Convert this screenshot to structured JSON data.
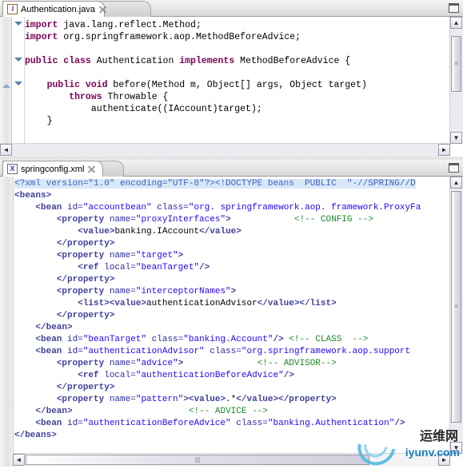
{
  "window": {
    "maximize_label": "Maximize"
  },
  "java_editor": {
    "tab": {
      "title": "Authentication.java",
      "icon": "java-file-icon",
      "icon_glyph": "J",
      "close_icon": "close-icon"
    },
    "lines": [
      [
        {
          "t": "import",
          "c": "kw"
        },
        {
          "t": " java.lang.reflect.Method;",
          "c": "plain"
        }
      ],
      [
        {
          "t": "import",
          "c": "kw"
        },
        {
          "t": " org.springframework.aop.MethodBeforeAdvice;",
          "c": "plain"
        }
      ],
      [],
      [
        {
          "t": "public class",
          "c": "kw"
        },
        {
          "t": " Authentication ",
          "c": "plain"
        },
        {
          "t": "implements",
          "c": "kw"
        },
        {
          "t": " MethodBeforeAdvice {",
          "c": "plain"
        }
      ],
      [],
      [
        {
          "t": "    ",
          "c": "plain"
        },
        {
          "t": "public void",
          "c": "kw"
        },
        {
          "t": " before(Method m, Object[] args, Object target)",
          "c": "plain"
        }
      ],
      [
        {
          "t": "        ",
          "c": "plain"
        },
        {
          "t": "throws",
          "c": "kw"
        },
        {
          "t": " Throwable {",
          "c": "plain"
        }
      ],
      [
        {
          "t": "            authenticate((IAccount)target);",
          "c": "plain"
        }
      ],
      [
        {
          "t": "    }",
          "c": "plain"
        }
      ]
    ],
    "fold_markers": [
      "collapse-fold-line-1",
      "collapse-fold-line-4",
      "collapse-fold-line-6"
    ],
    "scroll": {
      "vertical_up": "▲",
      "vertical_down": "▼",
      "horizontal_left": "◄",
      "horizontal_right": "►"
    }
  },
  "xml_editor": {
    "tab": {
      "title": "springconfig.xml",
      "icon": "xml-file-icon",
      "icon_glyph": "X",
      "close_icon": "close-icon"
    },
    "lines": [
      [
        {
          "t": "<?xml version=\"1.0\" encoding=\"UTF-8\"?><!DOCTYPE beans  PUBLIC  \"-//SPRING//D",
          "c": "xdecl hl"
        }
      ],
      [
        {
          "t": "<beans>",
          "c": "xtag"
        }
      ],
      [
        {
          "t": "    ",
          "c": "xtext"
        },
        {
          "t": "<bean ",
          "c": "xtag"
        },
        {
          "t": "id=",
          "c": "xattr"
        },
        {
          "t": "\"accountbean\"",
          "c": "xval"
        },
        {
          "t": " class=",
          "c": "xattr"
        },
        {
          "t": "\"org. springframework.aop. framework.ProxyFa",
          "c": "xval"
        }
      ],
      [
        {
          "t": "        ",
          "c": "xtext"
        },
        {
          "t": "<property ",
          "c": "xtag"
        },
        {
          "t": "name=",
          "c": "xattr"
        },
        {
          "t": "\"proxyInterfaces\"",
          "c": "xval"
        },
        {
          "t": ">",
          "c": "xtag"
        },
        {
          "t": "            ",
          "c": "xtext"
        },
        {
          "t": "<!-- CONFIG -->",
          "c": "xcom"
        }
      ],
      [
        {
          "t": "            ",
          "c": "xtext"
        },
        {
          "t": "<value>",
          "c": "xtag"
        },
        {
          "t": "banking.IAccount",
          "c": "xtext"
        },
        {
          "t": "</value>",
          "c": "xtag"
        }
      ],
      [
        {
          "t": "        ",
          "c": "xtext"
        },
        {
          "t": "</property>",
          "c": "xtag"
        }
      ],
      [
        {
          "t": "        ",
          "c": "xtext"
        },
        {
          "t": "<property ",
          "c": "xtag"
        },
        {
          "t": "name=",
          "c": "xattr"
        },
        {
          "t": "\"target\"",
          "c": "xval"
        },
        {
          "t": ">",
          "c": "xtag"
        }
      ],
      [
        {
          "t": "            ",
          "c": "xtext"
        },
        {
          "t": "<ref ",
          "c": "xtag"
        },
        {
          "t": "local=",
          "c": "xattr"
        },
        {
          "t": "\"beanTarget\"",
          "c": "xval"
        },
        {
          "t": "/>",
          "c": "xtag"
        }
      ],
      [
        {
          "t": "        ",
          "c": "xtext"
        },
        {
          "t": "</property>",
          "c": "xtag"
        }
      ],
      [
        {
          "t": "        ",
          "c": "xtext"
        },
        {
          "t": "<property ",
          "c": "xtag"
        },
        {
          "t": "name=",
          "c": "xattr"
        },
        {
          "t": "\"interceptorNames\"",
          "c": "xval"
        },
        {
          "t": ">",
          "c": "xtag"
        }
      ],
      [
        {
          "t": "            ",
          "c": "xtext"
        },
        {
          "t": "<list><value>",
          "c": "xtag"
        },
        {
          "t": "authenticationAdvisor",
          "c": "xtext"
        },
        {
          "t": "</value></list>",
          "c": "xtag"
        }
      ],
      [
        {
          "t": "        ",
          "c": "xtext"
        },
        {
          "t": "</property>",
          "c": "xtag"
        }
      ],
      [
        {
          "t": "    ",
          "c": "xtext"
        },
        {
          "t": "</bean>",
          "c": "xtag"
        }
      ],
      [
        {
          "t": "    ",
          "c": "xtext"
        },
        {
          "t": "<bean ",
          "c": "xtag"
        },
        {
          "t": "id=",
          "c": "xattr"
        },
        {
          "t": "\"beanTarget\"",
          "c": "xval"
        },
        {
          "t": " class=",
          "c": "xattr"
        },
        {
          "t": "\"banking.Account\"",
          "c": "xval"
        },
        {
          "t": "/>",
          "c": "xtag"
        },
        {
          "t": " ",
          "c": "xtext"
        },
        {
          "t": "<!-- CLASS  -->",
          "c": "xcom"
        }
      ],
      [
        {
          "t": "    ",
          "c": "xtext"
        },
        {
          "t": "<bean ",
          "c": "xtag"
        },
        {
          "t": "id=",
          "c": "xattr"
        },
        {
          "t": "\"authenticationAdvisor\"",
          "c": "xval"
        },
        {
          "t": " class=",
          "c": "xattr"
        },
        {
          "t": "\"org.springframework.aop.support",
          "c": "xval"
        }
      ],
      [
        {
          "t": "        ",
          "c": "xtext"
        },
        {
          "t": "<property ",
          "c": "xtag"
        },
        {
          "t": "name=",
          "c": "xattr"
        },
        {
          "t": "\"advice\"",
          "c": "xval"
        },
        {
          "t": ">",
          "c": "xtag"
        },
        {
          "t": "              ",
          "c": "xtext"
        },
        {
          "t": "<!-- ADVISOR-->",
          "c": "xcom"
        }
      ],
      [
        {
          "t": "            ",
          "c": "xtext"
        },
        {
          "t": "<ref ",
          "c": "xtag"
        },
        {
          "t": "local=",
          "c": "xattr"
        },
        {
          "t": "\"authenticationBeforeAdvice\"",
          "c": "xval"
        },
        {
          "t": "/>",
          "c": "xtag"
        }
      ],
      [
        {
          "t": "        ",
          "c": "xtext"
        },
        {
          "t": "</property>",
          "c": "xtag"
        }
      ],
      [
        {
          "t": "        ",
          "c": "xtext"
        },
        {
          "t": "<property ",
          "c": "xtag"
        },
        {
          "t": "name=",
          "c": "xattr"
        },
        {
          "t": "\"pattern\"",
          "c": "xval"
        },
        {
          "t": ">",
          "c": "xtag"
        },
        {
          "t": "<value>",
          "c": "xtag"
        },
        {
          "t": ".*",
          "c": "xtext"
        },
        {
          "t": "</value></property>",
          "c": "xtag"
        }
      ],
      [
        {
          "t": "    ",
          "c": "xtext"
        },
        {
          "t": "</bean>",
          "c": "xtag"
        },
        {
          "t": "                      ",
          "c": "xtext"
        },
        {
          "t": "<!-- ADVICE -->",
          "c": "xcom"
        }
      ],
      [
        {
          "t": "    ",
          "c": "xtext"
        },
        {
          "t": "<bean ",
          "c": "xtag"
        },
        {
          "t": "id=",
          "c": "xattr"
        },
        {
          "t": "\"authenticationBeforeAdvice\"",
          "c": "xval"
        },
        {
          "t": " class=",
          "c": "xattr"
        },
        {
          "t": "\"banking.Authentication\"",
          "c": "xval"
        },
        {
          "t": "/>",
          "c": "xtag"
        }
      ],
      [
        {
          "t": "</beans>",
          "c": "xtag"
        }
      ]
    ],
    "scroll": {
      "vertical_up": "▲",
      "vertical_down": "▼",
      "horizontal_left": "◄",
      "horizontal_right": "►"
    }
  },
  "watermark": {
    "cn": "运维网",
    "en": "iyunv.com"
  }
}
